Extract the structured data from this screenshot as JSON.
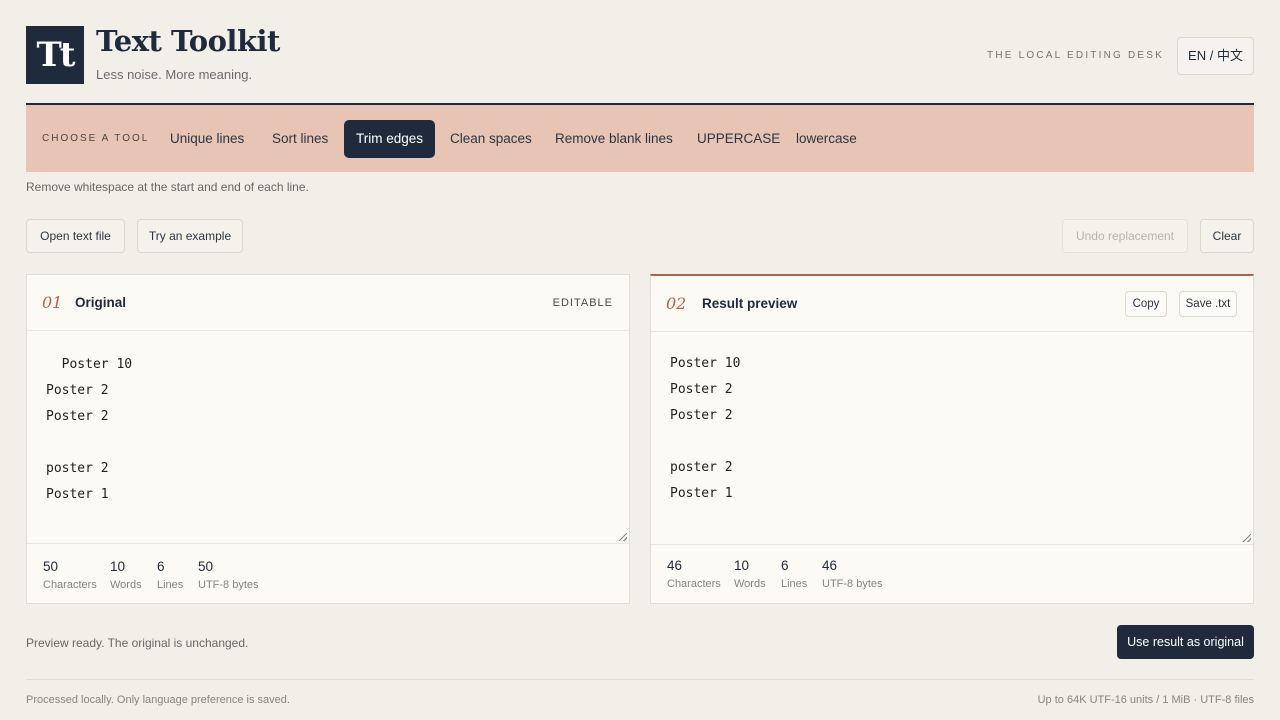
{
  "header": {
    "logo_text": "Tt",
    "title": "Text Toolkit",
    "tagline": "Less noise. More meaning.",
    "desk_label": "THE LOCAL EDITING DESK",
    "language_button": "EN / 中文"
  },
  "toolbar": {
    "label": "CHOOSE A TOOL",
    "tools": [
      {
        "label": "Unique lines",
        "active": false
      },
      {
        "label": "Sort lines",
        "active": false
      },
      {
        "label": "Trim edges",
        "active": true
      },
      {
        "label": "Clean spaces",
        "active": false
      },
      {
        "label": "Remove blank lines",
        "active": false
      },
      {
        "label": "UPPERCASE",
        "active": false
      },
      {
        "label": "lowercase",
        "active": false
      }
    ],
    "description": "Remove whitespace at the start and end of each line."
  },
  "actions": {
    "open_file": "Open text file",
    "try_example": "Try an example",
    "undo": "Undo replacement",
    "clear": "Clear"
  },
  "original": {
    "number": "01",
    "title": "Original",
    "tag": "EDITABLE",
    "lines": [
      "  Poster 10",
      "Poster 2",
      "Poster 2",
      "",
      "poster 2",
      "Poster 1"
    ],
    "stats": [
      {
        "value": "50",
        "label": "Characters"
      },
      {
        "value": "10",
        "label": "Words"
      },
      {
        "value": "6",
        "label": "Lines"
      },
      {
        "value": "50",
        "label": "UTF-8 bytes"
      }
    ]
  },
  "result": {
    "number": "02",
    "title": "Result preview",
    "copy_button": "Copy",
    "save_button": "Save .txt",
    "lines": [
      "Poster 10",
      "Poster 2",
      "Poster 2",
      "",
      "poster 2",
      "Poster 1"
    ],
    "stats": [
      {
        "value": "46",
        "label": "Characters"
      },
      {
        "value": "10",
        "label": "Words"
      },
      {
        "value": "6",
        "label": "Lines"
      },
      {
        "value": "46",
        "label": "UTF-8 bytes"
      }
    ]
  },
  "status": "Preview ready. The original is unchanged.",
  "use_result_button": "Use result as original",
  "footer": {
    "left": "Processed locally. Only language preference is saved.",
    "right": "Up to 64K UTF-16 units / 1 MiB · UTF-8 files"
  },
  "colors": {
    "navy": "#1f2a3c",
    "accent": "#b4624e",
    "toolbar_bg": "#e8c4b4",
    "page_bg": "#f2efe9"
  }
}
